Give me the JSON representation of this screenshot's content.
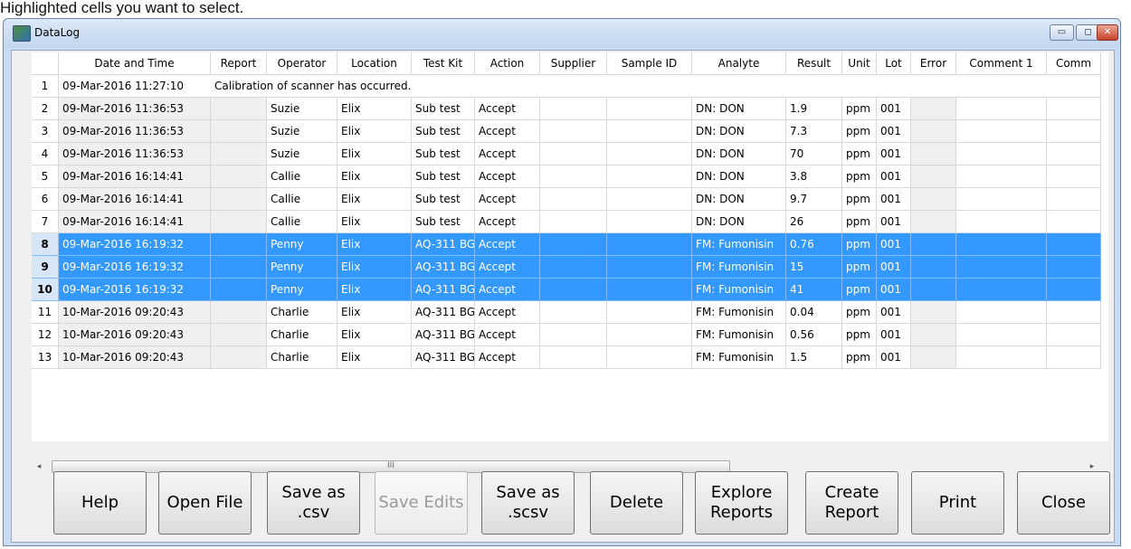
{
  "caption": "Highlighted cells you want to select.",
  "window": {
    "title": "DataLog",
    "controls": {
      "minimize": "▭",
      "maximize": "◻",
      "close": "✕"
    }
  },
  "grid": {
    "columns": [
      "Date and Time",
      "Report",
      "Operator",
      "Location",
      "Test Kit",
      "Action",
      "Supplier",
      "Sample ID",
      "Analyte",
      "Result",
      "Unit",
      "Lot",
      "Error",
      "Comment 1",
      "Comm"
    ],
    "rows": [
      {
        "n": "1",
        "datetime": "09-Mar-2016  11:27:10",
        "note": "Calibration of scanner has occurred."
      },
      {
        "n": "2",
        "datetime": "09-Mar-2016  11:36:53",
        "report": "",
        "operator": "Suzie",
        "location": "Elix",
        "testkit": "Sub test",
        "action": "Accept",
        "supplier": "",
        "sample": "",
        "analyte": "DN: DON",
        "result": "1.9",
        "unit": "ppm",
        "lot": "001",
        "error": "",
        "comment": "",
        "comm": ""
      },
      {
        "n": "3",
        "datetime": "09-Mar-2016  11:36:53",
        "report": "",
        "operator": "Suzie",
        "location": "Elix",
        "testkit": "Sub test",
        "action": "Accept",
        "supplier": "",
        "sample": "",
        "analyte": "DN: DON",
        "result": "7.3",
        "unit": "ppm",
        "lot": "001",
        "error": "",
        "comment": "",
        "comm": ""
      },
      {
        "n": "4",
        "datetime": "09-Mar-2016  11:36:53",
        "report": "",
        "operator": "Suzie",
        "location": "Elix",
        "testkit": "Sub test",
        "action": "Accept",
        "supplier": "",
        "sample": "",
        "analyte": "DN: DON",
        "result": "70",
        "unit": "ppm",
        "lot": "001",
        "error": "",
        "comment": "",
        "comm": ""
      },
      {
        "n": "5",
        "datetime": "09-Mar-2016  16:14:41",
        "report": "",
        "operator": "Callie",
        "location": "Elix",
        "testkit": "Sub test",
        "action": "Accept",
        "supplier": "",
        "sample": "",
        "analyte": "DN: DON",
        "result": "3.8",
        "unit": "ppm",
        "lot": "001",
        "error": "",
        "comment": "",
        "comm": ""
      },
      {
        "n": "6",
        "datetime": "09-Mar-2016  16:14:41",
        "report": "",
        "operator": "Callie",
        "location": "Elix",
        "testkit": "Sub test",
        "action": "Accept",
        "supplier": "",
        "sample": "",
        "analyte": "DN: DON",
        "result": "9.7",
        "unit": "ppm",
        "lot": "001",
        "error": "",
        "comment": "",
        "comm": ""
      },
      {
        "n": "7",
        "datetime": "09-Mar-2016  16:14:41",
        "report": "",
        "operator": "Callie",
        "location": "Elix",
        "testkit": "Sub test",
        "action": "Accept",
        "supplier": "",
        "sample": "",
        "analyte": "DN: DON",
        "result": "26",
        "unit": "ppm",
        "lot": "001",
        "error": "",
        "comment": "",
        "comm": ""
      },
      {
        "n": "8",
        "datetime": "09-Mar-2016  16:19:32",
        "report": "",
        "operator": "Penny",
        "location": "Elix",
        "testkit": "AQ-311 BG",
        "action": "Accept",
        "supplier": "",
        "sample": "",
        "analyte": "FM: Fumonisin",
        "result": "0.76",
        "unit": "ppm",
        "lot": "001",
        "error": "",
        "comment": "",
        "comm": "",
        "selected": true
      },
      {
        "n": "9",
        "datetime": "09-Mar-2016  16:19:32",
        "report": "",
        "operator": "Penny",
        "location": "Elix",
        "testkit": "AQ-311 BG",
        "action": "Accept",
        "supplier": "",
        "sample": "",
        "analyte": "FM: Fumonisin",
        "result": "15",
        "unit": "ppm",
        "lot": "001",
        "error": "",
        "comment": "",
        "comm": "",
        "selected": true
      },
      {
        "n": "10",
        "datetime": "09-Mar-2016  16:19:32",
        "report": "",
        "operator": "Penny",
        "location": "Elix",
        "testkit": "AQ-311 BG",
        "action": "Accept",
        "supplier": "",
        "sample": "",
        "analyte": "FM: Fumonisin",
        "result": "41",
        "unit": "ppm",
        "lot": "001",
        "error": "",
        "comment": "",
        "comm": "",
        "selected": true
      },
      {
        "n": "11",
        "datetime": "10-Mar-2016  09:20:43",
        "report": "",
        "operator": "Charlie",
        "location": "Elix",
        "testkit": "AQ-311 BG",
        "action": "Accept",
        "supplier": "",
        "sample": "",
        "analyte": "FM: Fumonisin",
        "result": "0.04",
        "unit": "ppm",
        "lot": "001",
        "error": "",
        "comment": "",
        "comm": ""
      },
      {
        "n": "12",
        "datetime": "10-Mar-2016  09:20:43",
        "report": "",
        "operator": "Charlie",
        "location": "Elix",
        "testkit": "AQ-311 BG",
        "action": "Accept",
        "supplier": "",
        "sample": "",
        "analyte": "FM: Fumonisin",
        "result": "0.56",
        "unit": "ppm",
        "lot": "001",
        "error": "",
        "comment": "",
        "comm": ""
      },
      {
        "n": "13",
        "datetime": "10-Mar-2016  09:20:43",
        "report": "",
        "operator": "Charlie",
        "location": "Elix",
        "testkit": "AQ-311 BG",
        "action": "Accept",
        "supplier": "",
        "sample": "",
        "analyte": "FM: Fumonisin",
        "result": "1.5",
        "unit": "ppm",
        "lot": "001",
        "error": "",
        "comment": "",
        "comm": ""
      }
    ]
  },
  "scrollbar": {
    "left_arrow": "◂",
    "right_arrow": "▸",
    "grip": "III"
  },
  "buttons": [
    {
      "id": "help",
      "label": "Help"
    },
    {
      "id": "open-file",
      "label": "Open File"
    },
    {
      "id": "save-csv",
      "label": "Save as\n.csv"
    },
    {
      "id": "save-edits",
      "label": "Save Edits",
      "disabled": true
    },
    {
      "id": "save-scsv",
      "label": "Save as\n.scsv"
    },
    {
      "id": "delete",
      "label": "Delete"
    },
    {
      "id": "explore-reports",
      "label": "Explore\nReports"
    },
    {
      "id": "create-report",
      "label": "Create\nReport"
    },
    {
      "id": "print",
      "label": "Print"
    },
    {
      "id": "close",
      "label": "Close"
    }
  ],
  "colors": {
    "selection": "#3399ff",
    "readonly_cell": "#f0f0f0",
    "window_frame": "#c9dcf2"
  }
}
